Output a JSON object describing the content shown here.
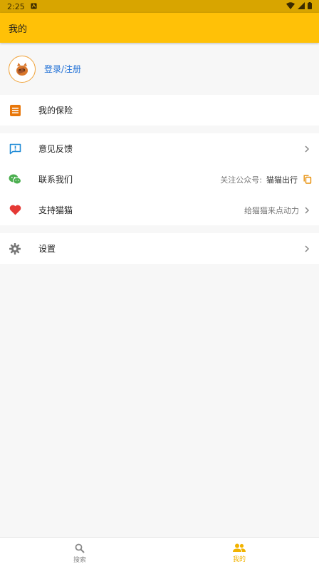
{
  "status_bar": {
    "time": "2:25"
  },
  "app_bar": {
    "title": "我的"
  },
  "profile": {
    "login_label": "登录/注册"
  },
  "menu": {
    "insurance": {
      "label": "我的保险"
    },
    "feedback": {
      "label": "意见反馈"
    },
    "contact": {
      "label": "联系我们",
      "hint": "关注公众号:",
      "account": "猫猫出行"
    },
    "support": {
      "label": "支持猫猫",
      "hint": "给猫猫来点动力"
    },
    "settings": {
      "label": "设置"
    }
  },
  "bottom_nav": {
    "search": {
      "label": "搜索"
    },
    "mine": {
      "label": "我的"
    }
  },
  "colors": {
    "accent": "#ffc107",
    "active_tab": "#f2b300",
    "link": "#1e6fd6"
  }
}
